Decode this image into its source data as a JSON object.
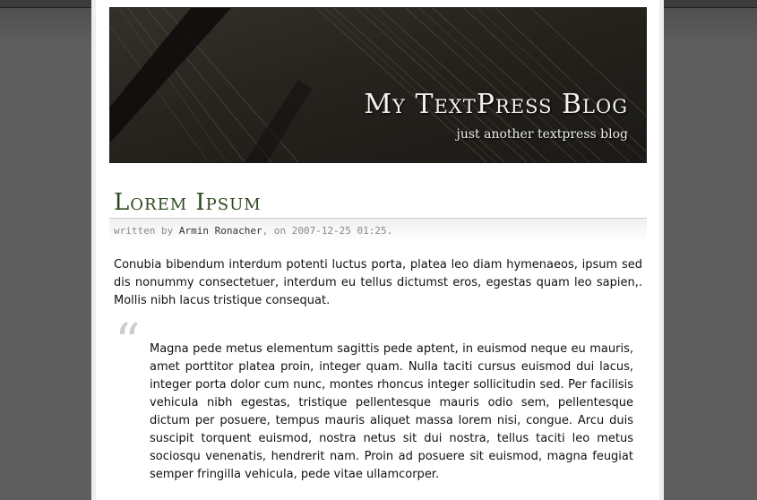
{
  "header": {
    "blog_title": "My TextPress Blog",
    "tagline": "just another textpress blog"
  },
  "post": {
    "title": "Lorem Ipsum",
    "meta": {
      "written_by": "written by",
      "author": "Armin Ronacher",
      "on": ", on",
      "date": "2007-12-25 01:25."
    },
    "paragraph": "Conubia bibendum interdum potenti luctus porta, platea leo diam hymenaeos, ipsum sed dis nonummy consectetuer, interdum eu tellus dictumst eros, egestas quam leo sapien,. Mollis nibh lacus tristique consequat.",
    "quote_mark": "“",
    "blockquote": "Magna pede metus elementum sagittis pede aptent, in euismod neque eu mauris, amet porttitor platea proin, integer quam. Nulla taciti cursus euismod dui lacus, integer porta dolor cum nunc, montes rhoncus integer sollicitudin sed. Per facilisis vehicula nibh egestas, tristique pellentesque mauris odio sem, pellentesque dictum per posuere, tempus mauris aliquet massa lorem nisi, congue. Arcu duis suscipit torquent euismod, nostra netus sit dui nostra, tellus taciti leo metus sociosqu venenatis, hendrerit nam. Proin ad posuere sit euismod, magna feugiat semper fringilla vehicula, pede vitae ullamcorper."
  },
  "colors": {
    "background": "#5e5e5e",
    "page": "#ffffff",
    "title_green": "#2f4a1f",
    "header_wood": "#2d2a24"
  }
}
